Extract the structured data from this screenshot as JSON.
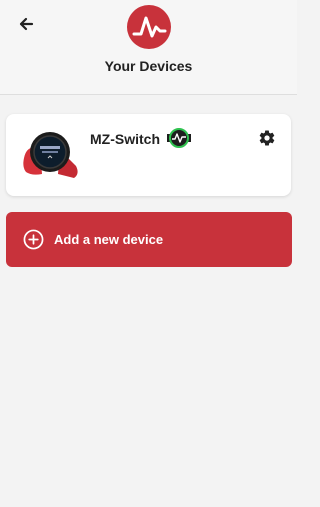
{
  "header": {
    "title": "Your Devices",
    "back_icon": "arrow-left-icon",
    "logo_icon": "heart-rate-logo-icon",
    "brand_color": "#c8323b"
  },
  "devices": [
    {
      "name": "MZ-Switch",
      "image": "watch-device-image",
      "status_icon": "connected-device-icon",
      "settings_icon": "gear-icon"
    }
  ],
  "add_device": {
    "label": "Add a new device",
    "icon": "plus-circle-icon"
  }
}
